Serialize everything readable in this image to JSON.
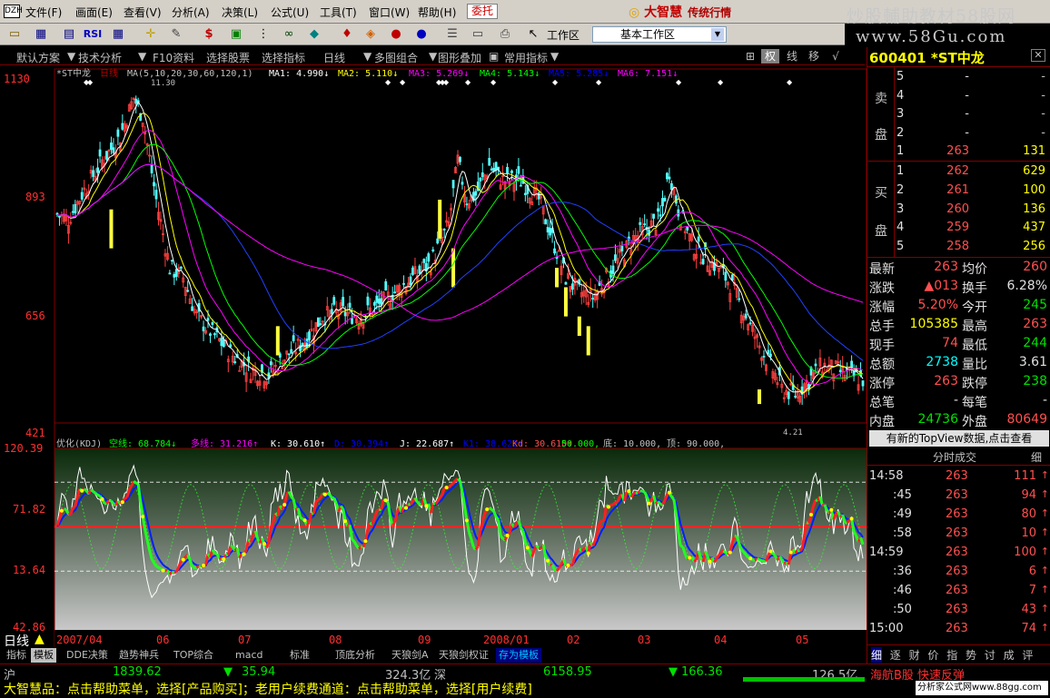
{
  "menubar": {
    "items": [
      "文件(F)",
      "画面(E)",
      "查看(V)",
      "分析(A)",
      "决策(L)",
      "公式(U)",
      "工具(T)",
      "窗口(W)",
      "帮助(H)"
    ],
    "weituo": "委托",
    "brand": "大智慧",
    "brand_sub": "传统行情",
    "watermark1": "炒股輔助教材58股网",
    "watermark2": "www.58Gu.com"
  },
  "toolbar": {
    "workspace_label": "工作区",
    "workspace_value": "基本工作区"
  },
  "secbar": {
    "items": [
      "默认方案",
      "技术分析",
      "F10资料",
      "选择股票",
      "选择指标",
      "日线",
      "多图组合",
      "图形叠加",
      "常用指标"
    ],
    "right_buttons": [
      "权",
      "线",
      "移",
      "√"
    ]
  },
  "main_chart": {
    "title_prefix": "*ST中龙",
    "period": "日线",
    "ma_params": "MA(5,10,20,30,60,120,1)",
    "ma_legend": [
      {
        "label": "MA1: 4.990↓",
        "color": "#ffffff"
      },
      {
        "label": "MA2: 5.110↓",
        "color": "#ffff00"
      },
      {
        "label": "MA3: 5.269↓",
        "color": "#ff00ff"
      },
      {
        "label": "MA4: 5.143↓",
        "color": "#00ff00"
      },
      {
        "label": "MA5: 5.285↓",
        "color": "#0000ff"
      },
      {
        "label": "MA6: 7.151↓",
        "color": "#ff00ff"
      }
    ],
    "y_ticks": [
      "1130",
      "893",
      "656",
      "421"
    ],
    "high_label": "11.30",
    "low_label": "4.21"
  },
  "sub_chart": {
    "title": "优化(KDJ)",
    "legend": [
      {
        "label": "空线: 68.784↓",
        "color": "#00ff00"
      },
      {
        "label": "多线: 31.216↑",
        "color": "#ff00ff"
      },
      {
        "label": "K: 30.610↑",
        "color": "#ffffff"
      },
      {
        "label": "D: 30.394↑",
        "color": "#0000ff"
      },
      {
        "label": "J: 22.687↑",
        "color": "#ffffff"
      },
      {
        "label": "K1: 38.622↑",
        "color": "#0000ff"
      },
      {
        "label": "Kd: 30.610↑",
        "color": "#ff5050"
      },
      {
        "label": "50.000,",
        "color": "#00ff00"
      },
      {
        "label": "底: 10.000,",
        "color": "#c0c0c0"
      },
      {
        "label": "顶: 90.000,",
        "color": "#c0c0c0"
      }
    ],
    "y_ticks": [
      "120.39",
      "71.82",
      "13.64",
      "42.86"
    ]
  },
  "x_axis": {
    "labels": [
      "2007/04",
      "06",
      "07",
      "08",
      "09",
      "2008/01",
      "02",
      "03",
      "04",
      "05"
    ]
  },
  "tabbar": {
    "period": "日线",
    "tabs": [
      "指标",
      "模板",
      "DDE决策",
      "趋势神兵",
      "TOP综合",
      "macd",
      "标准",
      "顶底分析",
      "天狼剑A",
      "天狼剑权证",
      "存为模板"
    ]
  },
  "statusbar": {
    "market1": "沪",
    "val1": "1839.62",
    "chg1": "35.94",
    "amt1": "324.3亿",
    "market2": "深",
    "val2": "6158.95",
    "chg2": "166.36",
    "amt2": "126.5亿",
    "message": "大智慧品：点击帮助菜单，选择[产品购买]；老用户续费通道：点击帮助菜单，选择[用户续费]",
    "ticker": "海航B股 快速反弹",
    "site": "分析家公式网www.88gg.com"
  },
  "quote": {
    "code": "600401",
    "name": "*ST中龙",
    "sell_label": [
      "卖",
      "盘"
    ],
    "buy_label": [
      "买",
      "盘"
    ],
    "sell": [
      {
        "lvl": "5",
        "price": "-",
        "vol": "-"
      },
      {
        "lvl": "4",
        "price": "-",
        "vol": "-"
      },
      {
        "lvl": "3",
        "price": "-",
        "vol": "-"
      },
      {
        "lvl": "2",
        "price": "-",
        "vol": "-"
      },
      {
        "lvl": "1",
        "price": "263",
        "vol": "131"
      }
    ],
    "buy": [
      {
        "lvl": "1",
        "price": "262",
        "vol": "629"
      },
      {
        "lvl": "2",
        "price": "261",
        "vol": "100"
      },
      {
        "lvl": "3",
        "price": "260",
        "vol": "136"
      },
      {
        "lvl": "4",
        "price": "259",
        "vol": "437"
      },
      {
        "lvl": "5",
        "price": "258",
        "vol": "256"
      }
    ],
    "stats": [
      {
        "l1": "最新",
        "v1": "263",
        "c1": "red",
        "l2": "均价",
        "v2": "260",
        "c2": "red"
      },
      {
        "l1": "涨跌",
        "v1": "▲013",
        "c1": "red",
        "l2": "换手",
        "v2": "6.28%",
        "c2": "wht"
      },
      {
        "l1": "涨幅",
        "v1": "5.20%",
        "c1": "red",
        "l2": "今开",
        "v2": "245",
        "c2": "green"
      },
      {
        "l1": "总手",
        "v1": "105385",
        "c1": "yel",
        "l2": "最高",
        "v2": "263",
        "c2": "red"
      },
      {
        "l1": "现手",
        "v1": "74",
        "c1": "red",
        "l2": "最低",
        "v2": "244",
        "c2": "green"
      },
      {
        "l1": "总额",
        "v1": "2738",
        "c1": "cyan",
        "l2": "量比",
        "v2": "3.61",
        "c2": "wht"
      },
      {
        "l1": "涨停",
        "v1": "263",
        "c1": "red",
        "l2": "跌停",
        "v2": "238",
        "c2": "green"
      },
      {
        "l1": "总笔",
        "v1": "-",
        "c1": "wht",
        "l2": "每笔",
        "v2": "-",
        "c2": "wht"
      },
      {
        "l1": "内盘",
        "v1": "24736",
        "c1": "green",
        "l2": "外盘",
        "v2": "80649",
        "c2": "red"
      }
    ],
    "topview": "有新的TopView数据,点击查看",
    "trades_header": "分时成交",
    "trades_header_r": "细",
    "trades": [
      {
        "t": "14:58",
        "p": "263",
        "v": "111",
        "a": "↑"
      },
      {
        "t": ":45",
        "p": "263",
        "v": "94",
        "a": "↑"
      },
      {
        "t": ":49",
        "p": "263",
        "v": "80",
        "a": "↑"
      },
      {
        "t": ":58",
        "p": "263",
        "v": "10",
        "a": "↑"
      },
      {
        "t": "14:59",
        "p": "263",
        "v": "100",
        "a": "↑"
      },
      {
        "t": ":36",
        "p": "263",
        "v": "6",
        "a": "↑"
      },
      {
        "t": ":46",
        "p": "263",
        "v": "7",
        "a": "↑"
      },
      {
        "t": ":50",
        "p": "263",
        "v": "43",
        "a": "↑"
      },
      {
        "t": "15:00",
        "p": "263",
        "v": "74",
        "a": "↑"
      }
    ],
    "bottom_tabs": [
      "细",
      "逐",
      "财",
      "价",
      "指",
      "势",
      "讨",
      "成",
      "评"
    ]
  }
}
